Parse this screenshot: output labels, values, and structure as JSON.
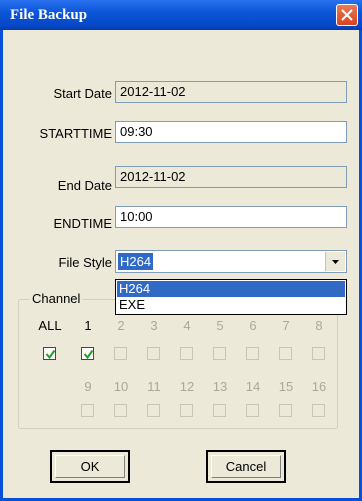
{
  "window": {
    "title": "File Backup"
  },
  "form": {
    "start_date_label": "Start Date",
    "start_date_value": "2012-11-02",
    "start_time_label": "STARTTIME",
    "start_time_value": "09:30",
    "end_date_label": "End Date",
    "end_date_value": "2012-11-02",
    "end_time_label": "ENDTIME",
    "end_time_value": "10:00",
    "file_style_label": "File Style",
    "file_style_value": "H264",
    "file_style_options": [
      "H264",
      "EXE"
    ]
  },
  "channel": {
    "group_label": "Channel",
    "all_label": "ALL",
    "row1_labels": [
      "1",
      "2",
      "3",
      "4",
      "5",
      "6",
      "7",
      "8"
    ],
    "row2_labels": [
      "9",
      "10",
      "11",
      "12",
      "13",
      "14",
      "15",
      "16"
    ],
    "all_checked": true,
    "checked": [
      "1"
    ]
  },
  "buttons": {
    "ok": "OK",
    "cancel": "Cancel"
  }
}
